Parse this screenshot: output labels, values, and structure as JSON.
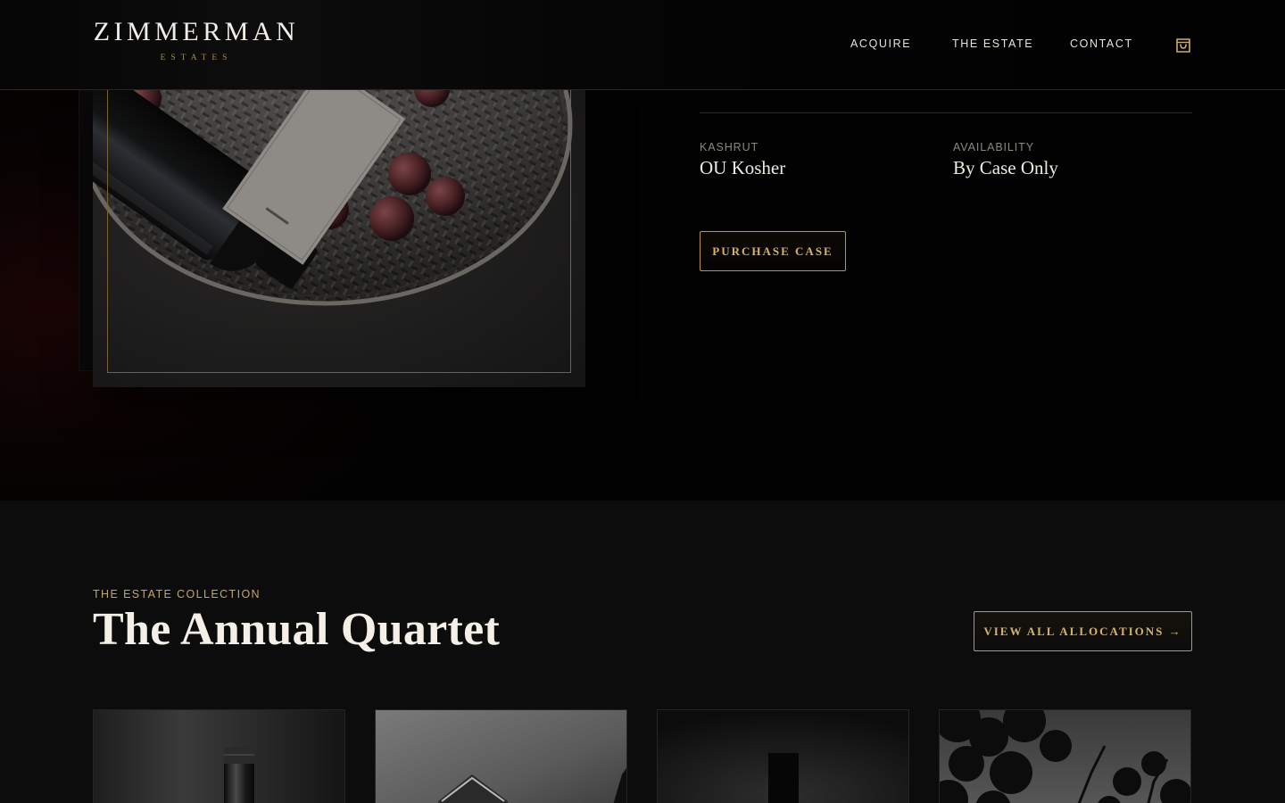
{
  "header": {
    "brand_name": "ZIMMERMAN",
    "brand_sub": "ESTATES",
    "nav": [
      {
        "label": "ACQUIRE"
      },
      {
        "label": "THE ESTATE"
      },
      {
        "label": "CONTACT"
      }
    ],
    "cart_icon": "shopping-bag-icon"
  },
  "product": {
    "specs": [
      {
        "label": "KASHRUT",
        "value": "OU Kosher"
      },
      {
        "label": "AVAILABILITY",
        "value": "By Case Only"
      }
    ],
    "purchase_label": "PURCHASE CASE"
  },
  "collection": {
    "eyebrow": "THE ESTATE COLLECTION",
    "title": "The Annual Quartet",
    "view_all_label": "VIEW ALL ALLOCATIONS →"
  },
  "colors": {
    "accent_gold": "#caa45f",
    "background": "#030303",
    "section_background": "#0c0c0c",
    "text": "#f4f0e8"
  }
}
